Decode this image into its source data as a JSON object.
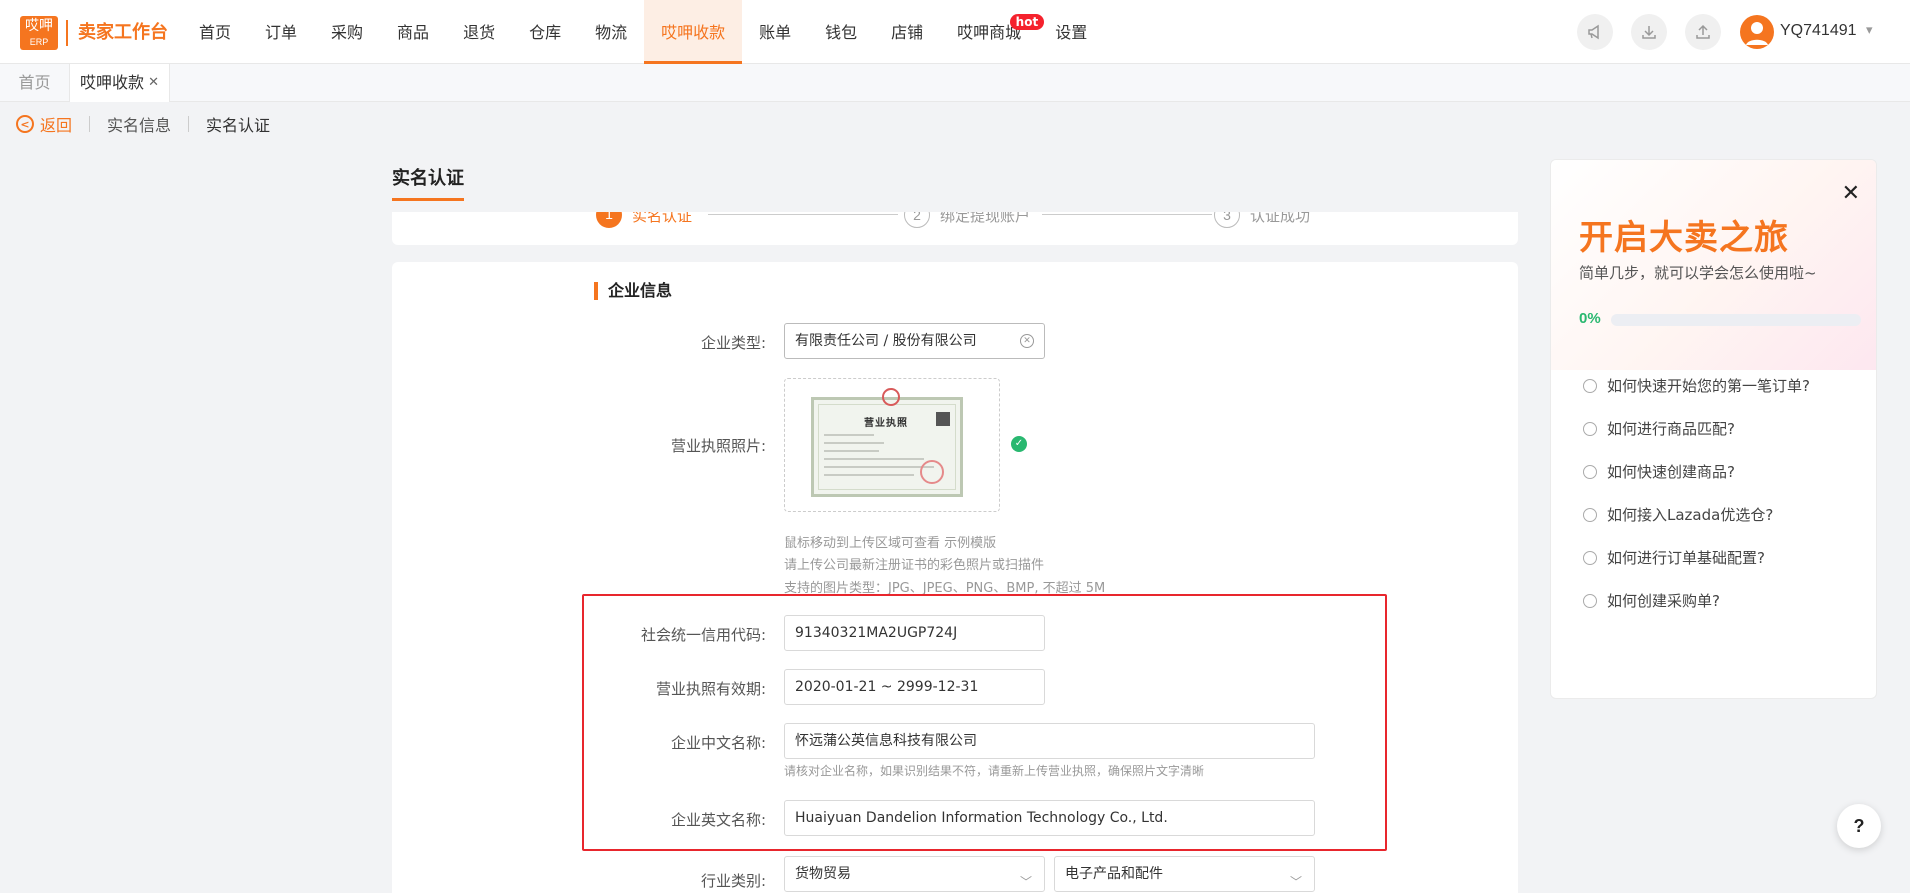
{
  "header": {
    "logo_text": "哎呷",
    "logo_sub": "ERP",
    "brand": "卖家工作台",
    "nav": [
      {
        "label": "首页"
      },
      {
        "label": "订单"
      },
      {
        "label": "采购"
      },
      {
        "label": "商品"
      },
      {
        "label": "退货"
      },
      {
        "label": "仓库"
      },
      {
        "label": "物流"
      },
      {
        "label": "哎呷收款",
        "active": true
      },
      {
        "label": "账单"
      },
      {
        "label": "钱包"
      },
      {
        "label": "店铺"
      },
      {
        "label": "哎呷商城",
        "badge": "hot"
      },
      {
        "label": "设置"
      }
    ],
    "username": "YQ741491",
    "icons": [
      "megaphone-icon",
      "download-icon",
      "upload-icon"
    ]
  },
  "tabs": [
    {
      "label": "首页"
    },
    {
      "label": "哎呷收款"
    }
  ],
  "breadcrumb": {
    "back": "返回",
    "items": [
      "实名信息",
      "实名认证"
    ]
  },
  "page": {
    "title": "实名认证",
    "steps": [
      {
        "num": "1",
        "label": "实名认证",
        "active": true
      },
      {
        "num": "2",
        "label": "绑定提现账户"
      },
      {
        "num": "3",
        "label": "认证成功"
      }
    ],
    "section_title": "企业信息",
    "fields": {
      "company_type": {
        "label": "企业类型:",
        "value": "有限责任公司 / 股份有限公司"
      },
      "license_photo": {
        "label": "营业执照照片:",
        "license_title": "营业执照"
      },
      "hints": [
        "鼠标移动到上传区域可查看 示例模版",
        "请上传公司最新注册证书的彩色照片或扫描件",
        "支持的图片类型：JPG、JPEG、PNG、BMP, 不超过 5M"
      ],
      "credit_code": {
        "label": "社会统一信用代码:",
        "value": "91340321MA2UGP724J"
      },
      "validity": {
        "label": "营业执照有效期:",
        "value": "2020-01-21 ~ 2999-12-31"
      },
      "cn_name": {
        "label": "企业中文名称:",
        "value": "怀远蒲公英信息科技有限公司",
        "hint": "请核对企业名称，如果识别结果不符，请重新上传营业执照，确保照片文字清晰"
      },
      "en_name": {
        "label": "企业英文名称:",
        "value": "Huaiyuan Dandelion Information Technology Co., Ltd."
      },
      "industry": {
        "label": "行业类别:",
        "value1": "货物贸易",
        "value2": "电子产品和配件"
      }
    }
  },
  "guide_panel": {
    "title": "开启大卖之旅",
    "subtitle": "简单几步，就可以学会怎么使用啦~",
    "progress_label": "0%",
    "progress": 0,
    "questions": [
      "如何快速开始您的第一笔订单?",
      "如何进行商品匹配?",
      "如何快速创建商品?",
      "如何接入Lazada优选仓?",
      "如何进行订单基础配置?",
      "如何创建采购单?"
    ]
  },
  "help_button": "?",
  "colors": {
    "accent": "#f5751f",
    "success": "#29b870",
    "highlight": "#e8262d"
  }
}
